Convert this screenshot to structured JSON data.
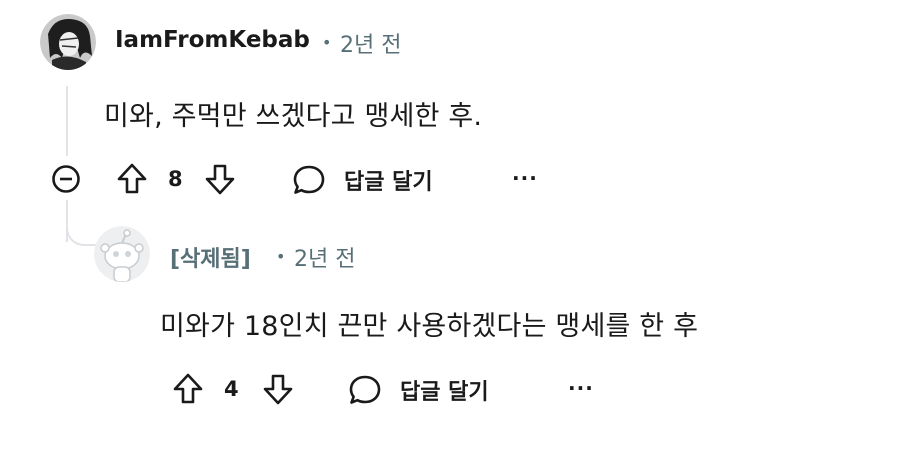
{
  "comment": {
    "username": "IamFromKebab",
    "dot": "•",
    "time": "2년 전",
    "body": "미와, 주먹만 쓰겠다고 맹세한 후.",
    "votes": "8",
    "reply_label": "답글 달기",
    "more_label": "···"
  },
  "reply": {
    "username": "[삭제됨]",
    "dot": "•",
    "time": "2년 전",
    "body": "미와가 18인치 끈만 사용하겠다는 맹세를 한 후",
    "votes": "4",
    "reply_label": "답글 달기",
    "more_label": "···"
  },
  "icons": {
    "collapse": "minus-circle-icon",
    "upvote": "arrow-up-icon",
    "downvote": "arrow-down-icon",
    "reply": "speech-bubble-icon",
    "more": "ellipsis-icon"
  },
  "colors": {
    "text": "#1a1a1b",
    "meta": "#576f76",
    "thread": "#e1e3e6"
  }
}
